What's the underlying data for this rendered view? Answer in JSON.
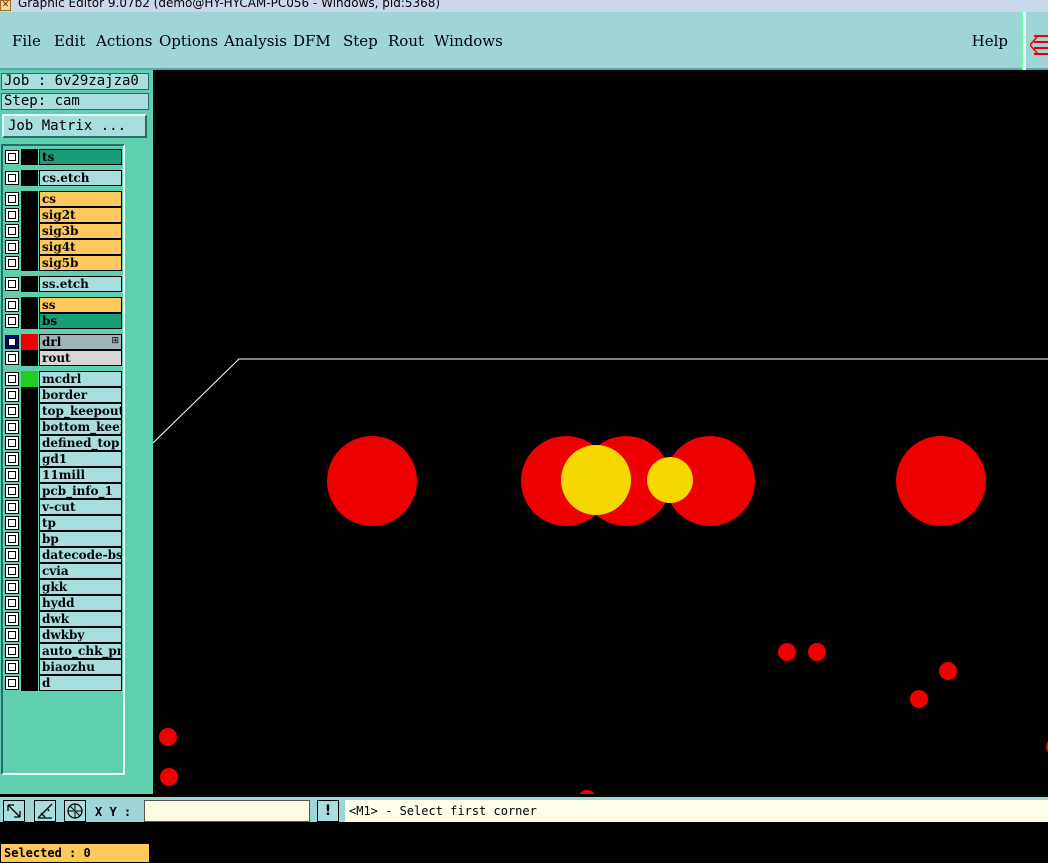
{
  "window": {
    "title": "Graphic Editor 9.07b2 (demo@HY-HYCAM-PC056 - Windows, pid:5368)"
  },
  "menubar": {
    "items": [
      "File",
      "Edit",
      "Actions",
      "Options",
      "Analysis",
      "DFM",
      "Step",
      "Rout",
      "Windows"
    ],
    "help": "Help"
  },
  "job": {
    "label": "Job : 6v29zajza0"
  },
  "step": {
    "label": "Step: cam"
  },
  "job_matrix_button": "Job Matrix ...",
  "layers": [
    {
      "name": "ts",
      "color": "#1a9e7a",
      "swatch": "#000000",
      "active": false
    },
    {
      "name": "cs.etch",
      "color": "#a8dede",
      "swatch": "#000000",
      "active": false
    },
    {
      "name": "cs",
      "color": "#ffc85a",
      "swatch": "#000000",
      "active": false
    },
    {
      "name": "sig2t",
      "color": "#ffc85a",
      "swatch": "#000000",
      "active": false
    },
    {
      "name": "sig3b",
      "color": "#ffc85a",
      "swatch": "#000000",
      "active": false
    },
    {
      "name": "sig4t",
      "color": "#ffc85a",
      "swatch": "#000000",
      "active": false
    },
    {
      "name": "sig5b",
      "color": "#ffc85a",
      "swatch": "#000000",
      "active": false
    },
    {
      "name": "ss.etch",
      "color": "#a8dede",
      "swatch": "#000000",
      "active": false
    },
    {
      "name": "ss",
      "color": "#ffc85a",
      "swatch": "#000000",
      "active": false
    },
    {
      "name": "bs",
      "color": "#1a9e7a",
      "swatch": "#000000",
      "active": false
    },
    {
      "name": "drl",
      "color": "#9fb3b8",
      "swatch": "#ee0000",
      "active": true
    },
    {
      "name": "rout",
      "color": "#d8d8d8",
      "swatch": "#000000",
      "active": false
    },
    {
      "name": "mcdrl",
      "color": "#a8dede",
      "swatch": "#22cc22",
      "active": false
    },
    {
      "name": "border",
      "color": "#a8dede",
      "swatch": "#000000",
      "active": false
    },
    {
      "name": "top_keepout",
      "color": "#a8dede",
      "swatch": "#000000",
      "active": false
    },
    {
      "name": "bottom_keepout",
      "color": "#a8dede",
      "swatch": "#000000",
      "active": false
    },
    {
      "name": "defined_top",
      "color": "#a8dede",
      "swatch": "#000000",
      "active": false
    },
    {
      "name": "gd1",
      "color": "#a8dede",
      "swatch": "#000000",
      "active": false
    },
    {
      "name": "11mill",
      "color": "#a8dede",
      "swatch": "#000000",
      "active": false
    },
    {
      "name": "pcb_info_1",
      "color": "#a8dede",
      "swatch": "#000000",
      "active": false
    },
    {
      "name": "v-cut",
      "color": "#a8dede",
      "swatch": "#000000",
      "active": false
    },
    {
      "name": "tp",
      "color": "#a8dede",
      "swatch": "#000000",
      "active": false
    },
    {
      "name": "bp",
      "color": "#a8dede",
      "swatch": "#000000",
      "active": false
    },
    {
      "name": "datecode-bs",
      "color": "#a8dede",
      "swatch": "#000000",
      "active": false
    },
    {
      "name": "cvia",
      "color": "#a8dede",
      "swatch": "#000000",
      "active": false
    },
    {
      "name": "gkk",
      "color": "#a8dede",
      "swatch": "#000000",
      "active": false
    },
    {
      "name": "hydd",
      "color": "#a8dede",
      "swatch": "#000000",
      "active": false
    },
    {
      "name": "dwk",
      "color": "#a8dede",
      "swatch": "#000000",
      "active": false
    },
    {
      "name": "dwkby",
      "color": "#a8dede",
      "swatch": "#000000",
      "active": false
    },
    {
      "name": "auto_chk_pnl",
      "color": "#a8dede",
      "swatch": "#000000",
      "active": false
    },
    {
      "name": "biaozhu",
      "color": "#a8dede",
      "swatch": "#000000",
      "active": false
    },
    {
      "name": "d",
      "color": "#a8dede",
      "swatch": "#000000",
      "active": false
    }
  ],
  "selected": {
    "label": "Selected : 0"
  },
  "statusbar": {
    "xy_label": "X Y :",
    "xy_value": "",
    "bang": "!",
    "message": "<M1> - Select first corner"
  },
  "colors": {
    "pad_red": "#ee0000",
    "pad_yellow": "#f5d800",
    "outline": "#ffffff"
  }
}
